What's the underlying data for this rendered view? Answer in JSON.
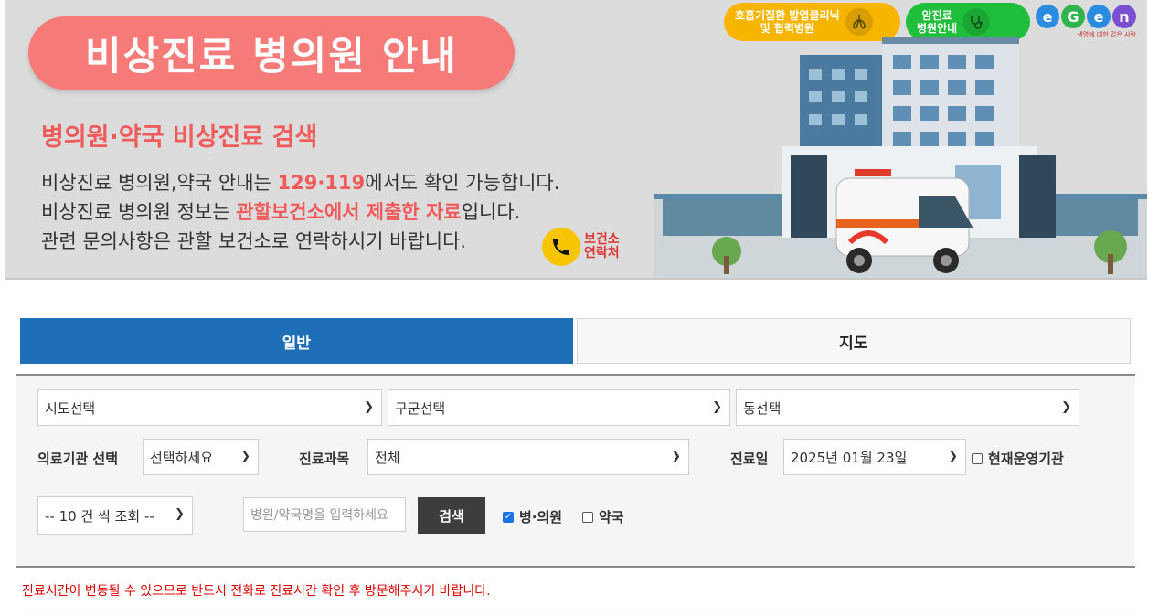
{
  "banner": {
    "title": "비상진료 병의원 안내",
    "subtitle": "병의원·약국 비상진료 검색",
    "line1": {
      "pre": "비상진료 병의원,약국 안내는 ",
      "hl": "129·119",
      "post": "에서도 확인 가능합니다."
    },
    "line2": {
      "pre": "비상진료 병의원 정보는 ",
      "hl": "관할보건소에서 제출한 자료",
      "post": "입니다."
    },
    "line3": "관련 문의사항은 관할 보건소로 연락하시기 바랍니다.",
    "contact_line1": "보건소",
    "contact_line2": "연락처",
    "badge_yellow_line1": "호흡기질환 발열클리닉",
    "badge_yellow_line2": "및 협력병원",
    "badge_green_line1": "암진료",
    "badge_green_line2": "병원안내",
    "egen_letters": [
      "e",
      "G",
      "e",
      "n"
    ],
    "egen_tagline": "생명에 대한 같은 사랑"
  },
  "tabs": [
    {
      "label": "일반",
      "active": true
    },
    {
      "label": "지도",
      "active": false
    }
  ],
  "filters": {
    "sido": "시도선택",
    "gugun": "구군선택",
    "dong": "동선택",
    "facility_label": "의료기관 선택",
    "facility_value": "선택하세요",
    "dept_label": "진료과목",
    "dept_value": "전체",
    "date_label": "진료일",
    "date_value": "2025년 01월 23일",
    "operating_label": "현재운영기관",
    "operating_checked": false,
    "page_size": "-- 10 건 씩 조회 --",
    "search_placeholder": "병원/약국명을 입력하세요",
    "search_button": "검색",
    "hospital_label": "병·의원",
    "hospital_checked": true,
    "pharmacy_label": "약국",
    "pharmacy_checked": false
  },
  "notice": "진료시간이 변동될 수 있으므로 반드시 전화로 진료시간 확인 후 방문해주시기 바랍니다.",
  "colors": {
    "accent": "#1e6fb8",
    "pill": "#f57a78",
    "highlight": "#f05a5a",
    "notice": "#e00000"
  }
}
